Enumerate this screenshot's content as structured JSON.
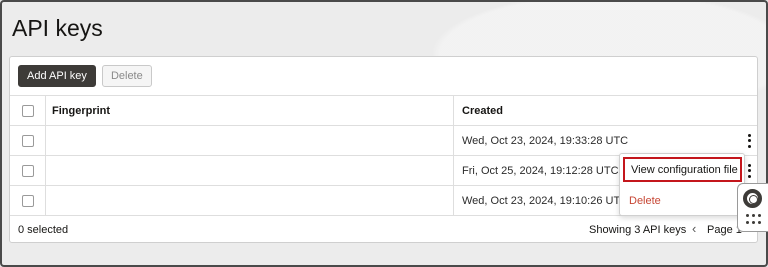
{
  "page": {
    "title": "API keys"
  },
  "toolbar": {
    "add_label": "Add API key",
    "delete_label": "Delete"
  },
  "table": {
    "columns": [
      "Fingerprint",
      "Created"
    ],
    "rows": [
      {
        "fingerprint": "",
        "created": "Wed, Oct 23, 2024, 19:33:28 UTC"
      },
      {
        "fingerprint": "",
        "created": "Fri, Oct 25, 2024, 19:12:28 UTC"
      },
      {
        "fingerprint": "",
        "created": "Wed, Oct 23, 2024, 19:10:26 UTC"
      }
    ]
  },
  "footer": {
    "selected": "0 selected",
    "showing": "Showing 3 API keys",
    "page_label": "Page 1"
  },
  "context_menu": {
    "view_label": "View configuration file",
    "delete_label": "Delete"
  },
  "colors": {
    "primary_button": "#3d3b38",
    "highlight_border": "#c4161c",
    "danger_text": "#c74634"
  },
  "icons": [
    "kebab-icon",
    "chevron-left-icon",
    "lifebuoy-icon",
    "grid-dots-icon"
  ]
}
